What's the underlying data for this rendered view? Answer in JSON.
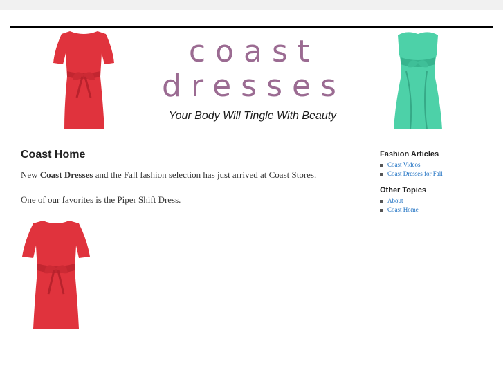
{
  "header": {
    "logo_line1": "coast",
    "logo_line2": "dresses",
    "tagline": "Your Body Will Tingle With Beauty",
    "logo_color": "#9b6b92"
  },
  "main": {
    "title": "Coast Home",
    "intro_before": "New ",
    "intro_bold": "Coast Dresses",
    "intro_after": " and the Fall fashion selection has just arrived at Coast Stores.",
    "favorite": "One of our favorites is the Piper Shift Dress."
  },
  "sidebar": {
    "sections": [
      {
        "heading": "Fashion Articles",
        "links": [
          "Coast Videos",
          "Coast Dresses for Fall"
        ]
      },
      {
        "heading": "Other Topics",
        "links": [
          "About",
          "Coast Home"
        ]
      }
    ],
    "link_color": "#1b6fc2"
  },
  "colors": {
    "red_dress": "#e0333d",
    "green_dress": "#4dd1a8"
  }
}
